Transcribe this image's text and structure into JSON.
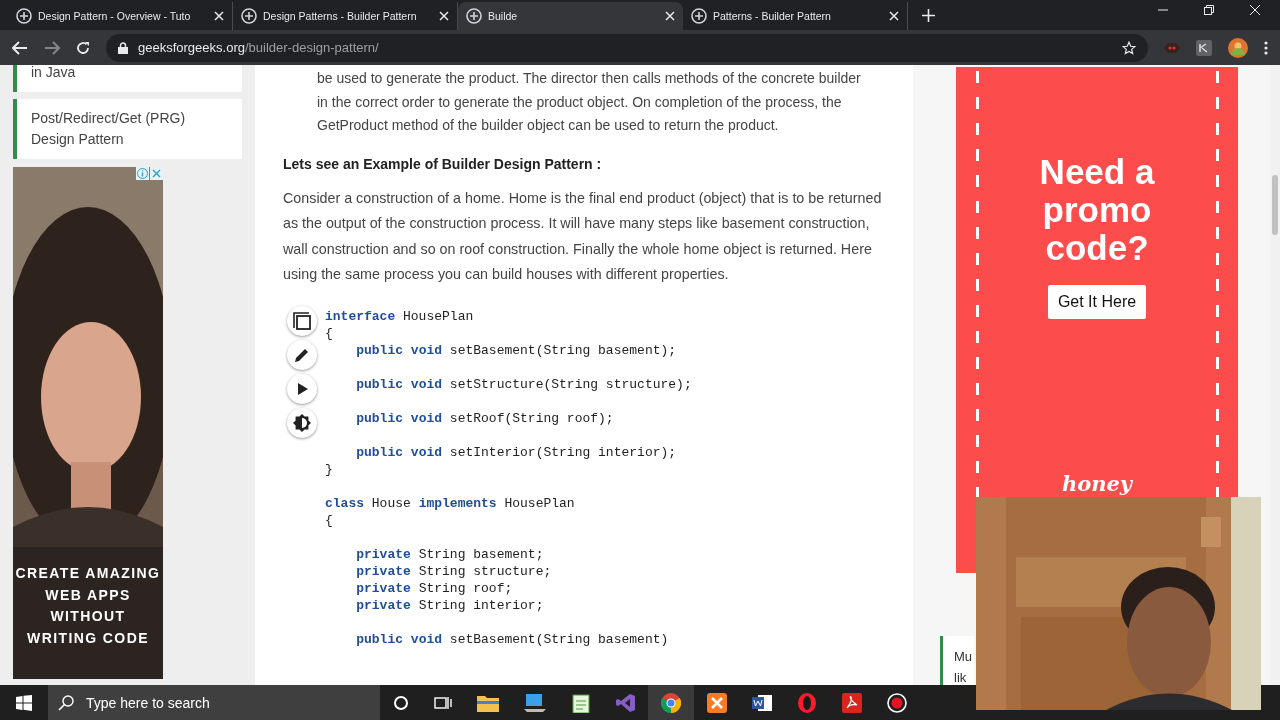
{
  "browser": {
    "tabs": [
      {
        "title": "Design Pattern - Overview - Tuto",
        "selected": false
      },
      {
        "title": "Design Patterns - Builder Pattern",
        "selected": false
      },
      {
        "title": "Builde",
        "selected": true
      },
      {
        "title": "Patterns - Builder Pattern",
        "selected": false
      }
    ],
    "url_host": "geeksforgeeks.org",
    "url_path": "/builder-design-pattern/"
  },
  "sidebar": {
    "items": [
      {
        "label": "in Java"
      },
      {
        "label": "Post/Redirect/Get (PRG) Design Pattern"
      }
    ],
    "ad_text": "CREATE AMAZING WEB APPS WITHOUT WRITING CODE"
  },
  "article": {
    "intro": "be used to generate the product. The director then calls methods of the concrete builder in the correct order to generate the product object. On completion of the process, the GetProduct method of the builder object can be used to return the product.",
    "heading": "Lets see an Example of Builder Design Pattern :",
    "paragraph": "Consider a construction of a home. Home is the final end product (object) that is to be returned as the output of the construction process. It will have many steps like basement construction, wall construction and so on roof construction. Finally the whole home object is returned. Here using the same process you can build houses with different properties.",
    "code_lines": [
      {
        "text": "**interface** HousePlan",
        "space_after": false
      },
      {
        "text": "{",
        "space_after": false
      },
      {
        "text": "    **public void** setBasement(String basement);",
        "space_after": true
      },
      {
        "text": "    **public void** setStructure(String structure);",
        "space_after": true
      },
      {
        "text": "    **public void** setRoof(String roof);",
        "space_after": true
      },
      {
        "text": "    **public void** setInterior(String interior);",
        "space_after": false
      },
      {
        "text": "}",
        "space_after": true
      },
      {
        "text": "**class** House **implements** HousePlan",
        "space_after": false
      },
      {
        "text": "{",
        "space_after": true
      },
      {
        "text": "    **private** String basement;",
        "space_after": false
      },
      {
        "text": "    **private** String structure;",
        "space_after": false
      },
      {
        "text": "    **private** String roof;",
        "space_after": false
      },
      {
        "text": "    **private** String interior;",
        "space_after": true
      },
      {
        "text": "    **public void** setBasement(String basement)",
        "space_after": false
      }
    ]
  },
  "promo": {
    "headline": "Need a promo code?",
    "button": "Get It Here",
    "brand": "honey"
  },
  "related": {
    "lines": [
      "Mu",
      "lik"
    ]
  },
  "taskbar": {
    "search_placeholder": "Type here to search"
  }
}
